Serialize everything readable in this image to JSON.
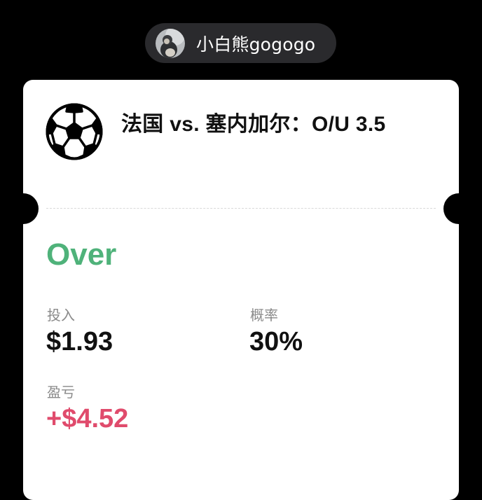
{
  "user": {
    "name": "小白熊gogogo",
    "avatar_icon": "user-avatar"
  },
  "ticket": {
    "sport_icon": "soccer-ball-icon",
    "match_title": "法国 vs. 塞内加尔：O/U 3.5",
    "selection": "Over",
    "selection_color": "#4fb27a",
    "stake": {
      "label": "投入",
      "value": "$1.93"
    },
    "probability": {
      "label": "概率",
      "value": "30%"
    },
    "pnl": {
      "label": "盈亏",
      "value": "+$4.52",
      "color": "#e04b6c"
    }
  }
}
